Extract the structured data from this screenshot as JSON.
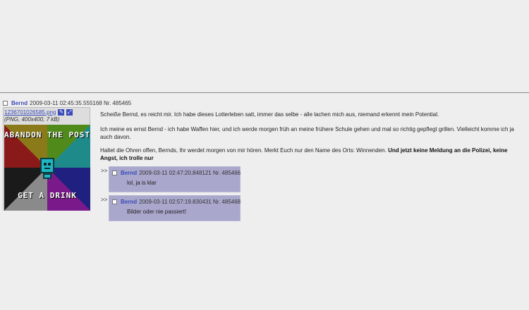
{
  "op": {
    "name": "Bernd",
    "datetime": "2009-03-11 02:45:35.555168",
    "number": "Nr. 485465",
    "file": {
      "filename": "1236701026585.png",
      "info": "(PNG, 400x400, 7 kB)",
      "image_text_top": "ABANDON THE POST",
      "image_text_bottom": "GET A DRINK"
    },
    "paragraphs": [
      "Scheiße Bernd, es reicht mir. Ich habe dieses Lotterleben satt, immer das selbe - alle lachen mich aus, niemand erkennt mein Potential.",
      "Ich meine es ernst Bernd - ich habe Waffen hier, und ich werde morgen früh an meine frühere Schule gehen und mal so richtig gepflegt grillen. Vielleicht komme ich ja auch davon.",
      "Haltet die Ohren offen, Bernds, Ihr werdet morgen von mir hören. Merkt Euch nur den Name des Orts: Winnenden."
    ],
    "bold_text": "Und jetzt keine Meldung an die Polizei, keine Angst, ich trolle nur"
  },
  "replies": [
    {
      "arrow": ">>",
      "name": "Bernd",
      "datetime": "2009-03-11 02:47:20.848121",
      "number": "Nr. 485466",
      "text": "lol, ja is klar"
    },
    {
      "arrow": ">>",
      "name": "Bernd",
      "datetime": "2009-03-11 02:57:19.830431",
      "number": "Nr. 485468",
      "text": "Bilder oder nie passiert!"
    }
  ]
}
